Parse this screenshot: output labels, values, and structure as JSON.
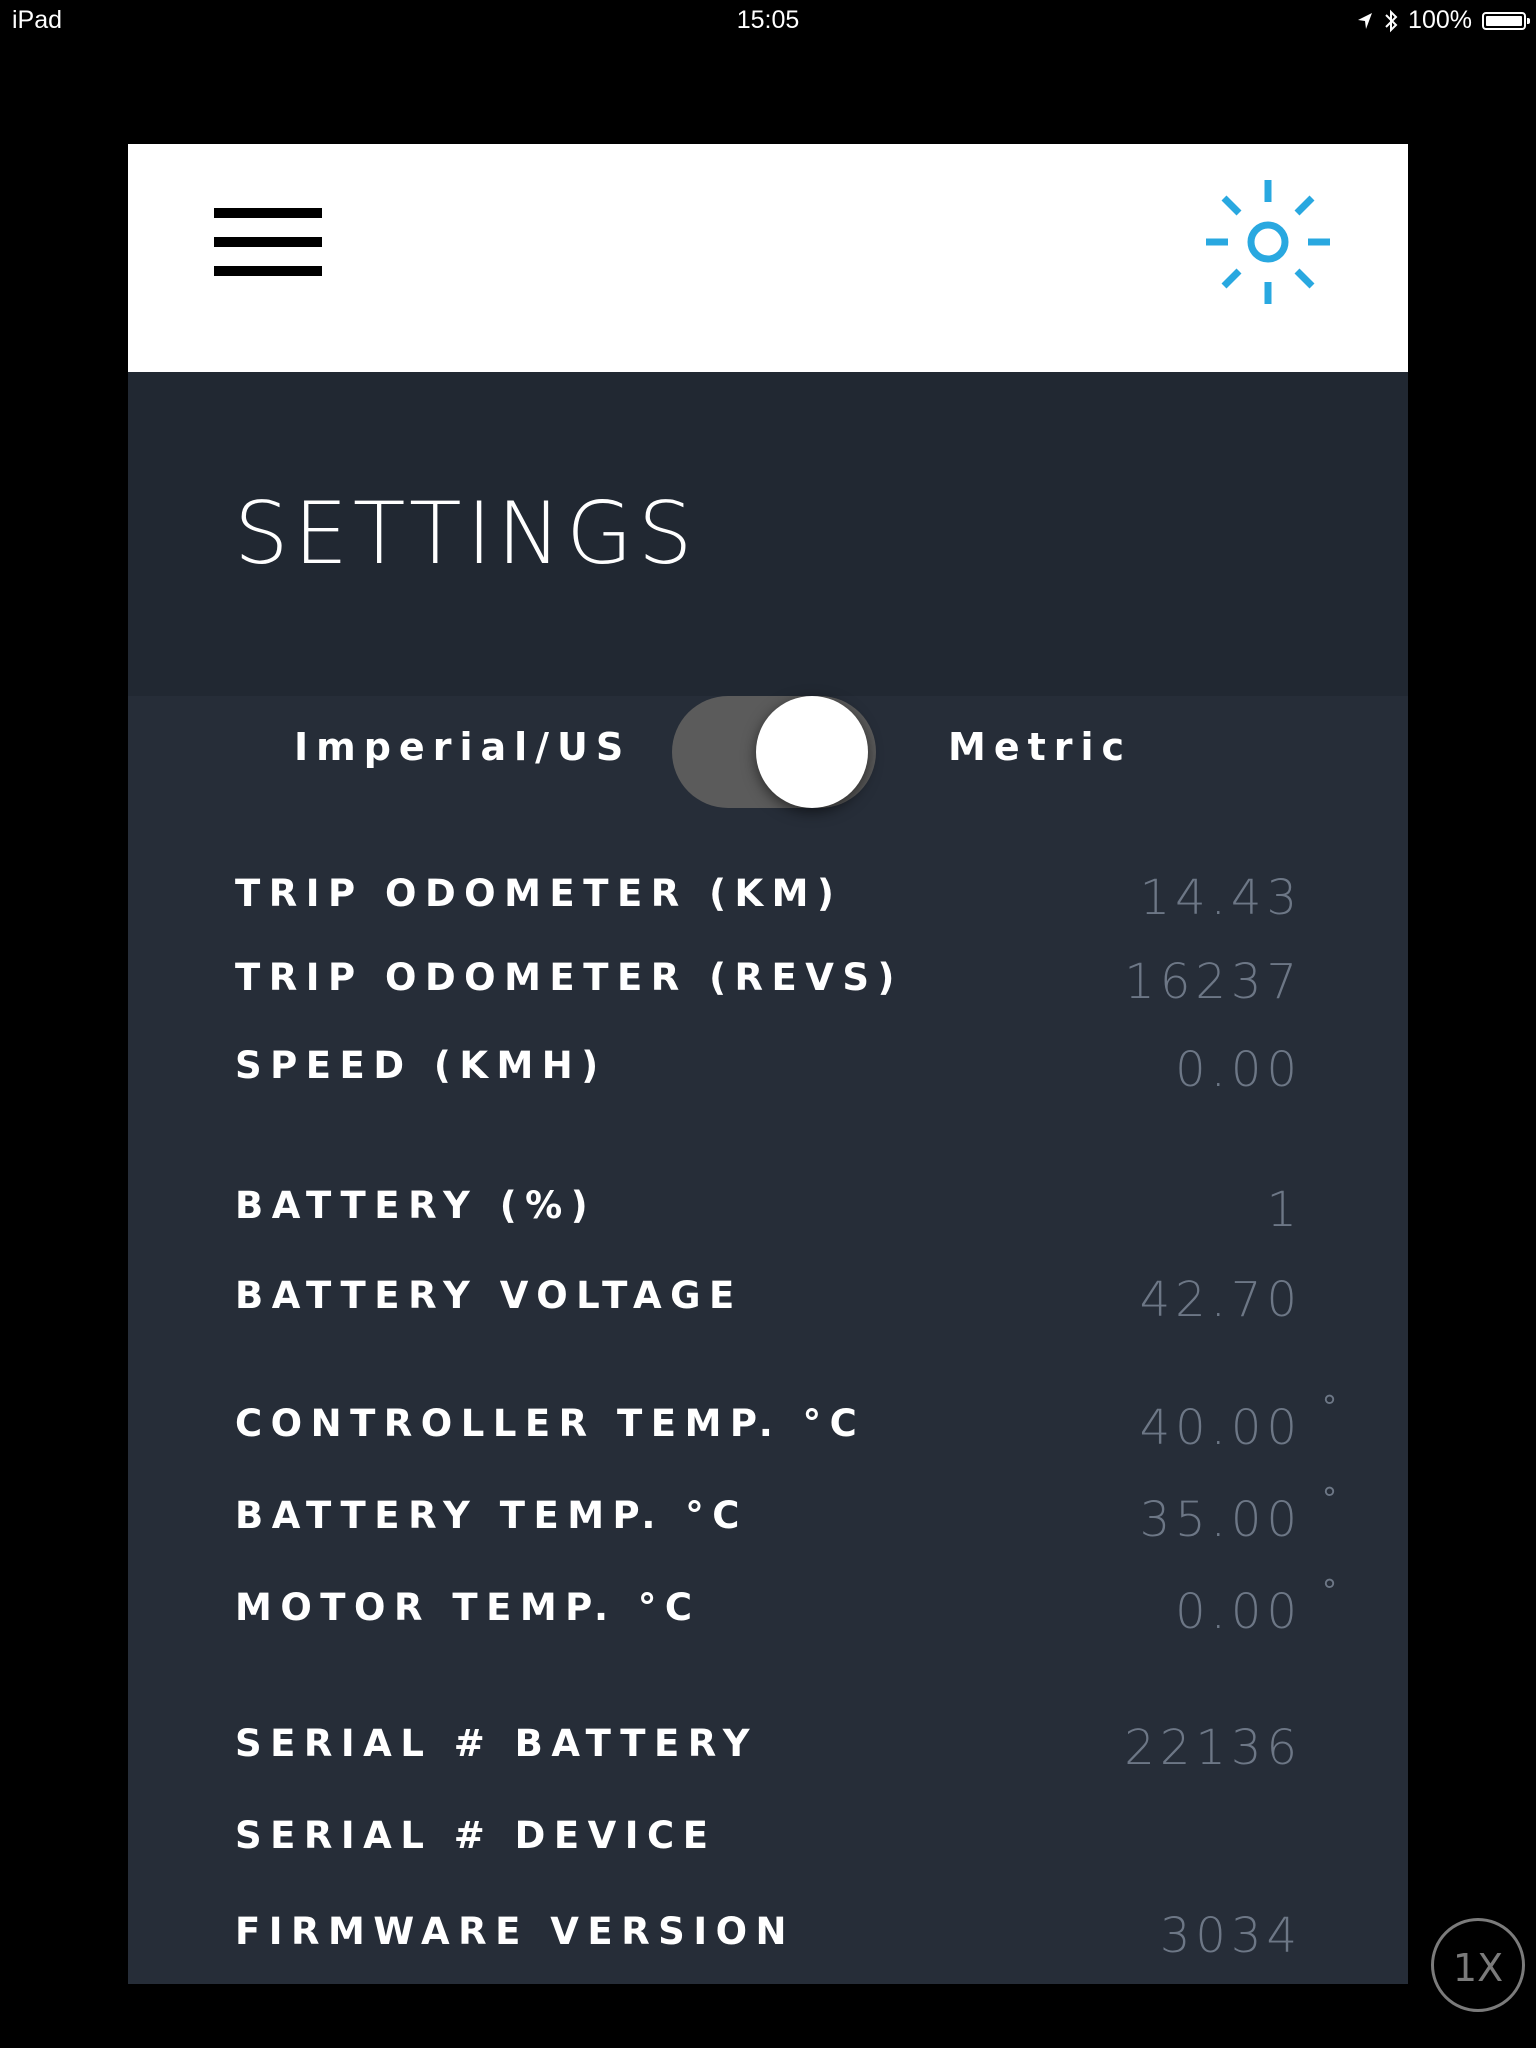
{
  "status_bar": {
    "device": "iPad",
    "time": "15:05",
    "battery": "100%"
  },
  "header": {
    "title": "SETTINGS",
    "menu_icon": "hamburger-menu-icon",
    "brightness_icon": "sun-icon",
    "accent_color": "#29a8e0"
  },
  "units": {
    "imperial_label": "Imperial/US",
    "metric_label": "Metric",
    "selected": "Metric"
  },
  "rows": [
    {
      "label": "TRIP ODOMETER (KM)",
      "value": "14.43"
    },
    {
      "label": "TRIP ODOMETER (REVS)",
      "value": "16237"
    },
    {
      "label": "SPEED (KMH)",
      "value": "0.00"
    },
    {
      "label": "BATTERY (%)",
      "value": "1"
    },
    {
      "label": "BATTERY VOLTAGE",
      "value": "42.70"
    },
    {
      "label": "CONTROLLER TEMP. °C",
      "value": "40.00",
      "suffix": "°"
    },
    {
      "label": "BATTERY TEMP. °C",
      "value": "35.00",
      "suffix": "°"
    },
    {
      "label": "MOTOR TEMP. °C",
      "value": "0.00",
      "suffix": "°"
    },
    {
      "label": "SERIAL # BATTERY",
      "value": "22136"
    },
    {
      "label": "SERIAL # DEVICE",
      "value": ""
    },
    {
      "label": "FIRMWARE VERSION",
      "value": "3034"
    }
  ],
  "zoom_badge": "1X"
}
